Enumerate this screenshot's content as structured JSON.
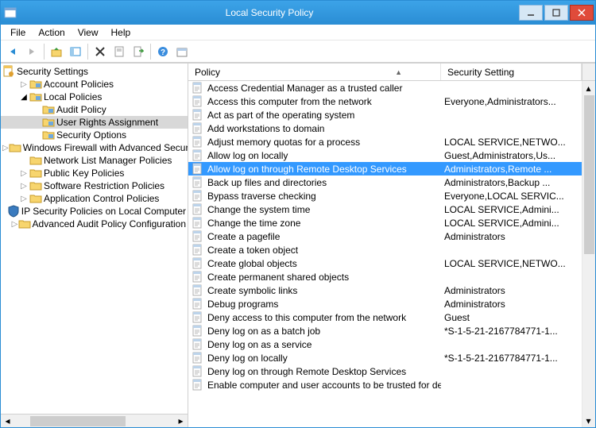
{
  "window": {
    "title": "Local Security Policy"
  },
  "menu": {
    "file": "File",
    "action": "Action",
    "view": "View",
    "help": "Help"
  },
  "tree": {
    "root": {
      "label": "Security Settings"
    },
    "items": [
      {
        "label": "Account Policies",
        "indent": 1,
        "icon": "folder-blue",
        "toggle": "closed"
      },
      {
        "label": "Local Policies",
        "indent": 1,
        "icon": "folder-blue",
        "toggle": "open"
      },
      {
        "label": "Audit Policy",
        "indent": 2,
        "icon": "folder-blue",
        "toggle": "none"
      },
      {
        "label": "User Rights Assignment",
        "indent": 2,
        "icon": "folder-blue",
        "toggle": "none",
        "selected": true
      },
      {
        "label": "Security Options",
        "indent": 2,
        "icon": "folder-blue",
        "toggle": "none"
      },
      {
        "label": "Windows Firewall with Advanced Security",
        "indent": 1,
        "icon": "folder",
        "toggle": "closed"
      },
      {
        "label": "Network List Manager Policies",
        "indent": 1,
        "icon": "folder",
        "toggle": "none"
      },
      {
        "label": "Public Key Policies",
        "indent": 1,
        "icon": "folder",
        "toggle": "closed"
      },
      {
        "label": "Software Restriction Policies",
        "indent": 1,
        "icon": "folder",
        "toggle": "closed"
      },
      {
        "label": "Application Control Policies",
        "indent": 1,
        "icon": "folder",
        "toggle": "closed"
      },
      {
        "label": "IP Security Policies on Local Computer",
        "indent": 1,
        "icon": "shield",
        "toggle": "none"
      },
      {
        "label": "Advanced Audit Policy Configuration",
        "indent": 1,
        "icon": "folder",
        "toggle": "closed"
      }
    ]
  },
  "list": {
    "columns": {
      "policy": "Policy",
      "setting": "Security Setting"
    },
    "rows": [
      {
        "policy": "Access Credential Manager as a trusted caller",
        "setting": ""
      },
      {
        "policy": "Access this computer from the network",
        "setting": "Everyone,Administrators..."
      },
      {
        "policy": "Act as part of the operating system",
        "setting": ""
      },
      {
        "policy": "Add workstations to domain",
        "setting": ""
      },
      {
        "policy": "Adjust memory quotas for a process",
        "setting": "LOCAL SERVICE,NETWO..."
      },
      {
        "policy": "Allow log on locally",
        "setting": "Guest,Administrators,Us..."
      },
      {
        "policy": "Allow log on through Remote Desktop Services",
        "setting": "Administrators,Remote ...",
        "selected": true
      },
      {
        "policy": "Back up files and directories",
        "setting": "Administrators,Backup ..."
      },
      {
        "policy": "Bypass traverse checking",
        "setting": "Everyone,LOCAL SERVIC..."
      },
      {
        "policy": "Change the system time",
        "setting": "LOCAL SERVICE,Admini..."
      },
      {
        "policy": "Change the time zone",
        "setting": "LOCAL SERVICE,Admini..."
      },
      {
        "policy": "Create a pagefile",
        "setting": "Administrators"
      },
      {
        "policy": "Create a token object",
        "setting": ""
      },
      {
        "policy": "Create global objects",
        "setting": "LOCAL SERVICE,NETWO..."
      },
      {
        "policy": "Create permanent shared objects",
        "setting": ""
      },
      {
        "policy": "Create symbolic links",
        "setting": "Administrators"
      },
      {
        "policy": "Debug programs",
        "setting": "Administrators"
      },
      {
        "policy": "Deny access to this computer from the network",
        "setting": "Guest"
      },
      {
        "policy": "Deny log on as a batch job",
        "setting": "*S-1-5-21-2167784771-1..."
      },
      {
        "policy": "Deny log on as a service",
        "setting": ""
      },
      {
        "policy": "Deny log on locally",
        "setting": "*S-1-5-21-2167784771-1..."
      },
      {
        "policy": "Deny log on through Remote Desktop Services",
        "setting": ""
      },
      {
        "policy": "Enable computer and user accounts to be trusted for delega",
        "setting": ""
      }
    ]
  }
}
